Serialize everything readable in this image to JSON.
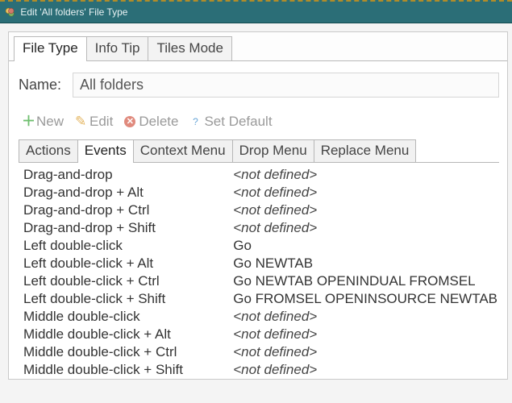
{
  "window": {
    "title": "Edit 'All folders' File Type"
  },
  "outer_tabs": [
    {
      "label": "File Type",
      "active": true
    },
    {
      "label": "Info Tip",
      "active": false
    },
    {
      "label": "Tiles Mode",
      "active": false
    }
  ],
  "name_field": {
    "label": "Name:",
    "value": "All folders"
  },
  "toolbar": {
    "new_label": "New",
    "edit_label": "Edit",
    "delete_label": "Delete",
    "set_default_label": "Set Default"
  },
  "inner_tabs": [
    {
      "label": "Actions",
      "active": false
    },
    {
      "label": "Events",
      "active": true
    },
    {
      "label": "Context Menu",
      "active": false
    },
    {
      "label": "Drop Menu",
      "active": false
    },
    {
      "label": "Replace Menu",
      "active": false
    }
  ],
  "events": [
    {
      "event": "Drag-and-drop",
      "action": "<not defined>",
      "defined": false
    },
    {
      "event": "Drag-and-drop + Alt",
      "action": "<not defined>",
      "defined": false
    },
    {
      "event": "Drag-and-drop + Ctrl",
      "action": "<not defined>",
      "defined": false
    },
    {
      "event": "Drag-and-drop + Shift",
      "action": "<not defined>",
      "defined": false
    },
    {
      "event": "Left double-click",
      "action": "Go",
      "defined": true
    },
    {
      "event": "Left double-click + Alt",
      "action": "Go NEWTAB",
      "defined": true
    },
    {
      "event": "Left double-click + Ctrl",
      "action": "Go NEWTAB OPENINDUAL FROMSEL",
      "defined": true
    },
    {
      "event": "Left double-click + Shift",
      "action": "Go FROMSEL OPENINSOURCE NEWTAB",
      "defined": true
    },
    {
      "event": "Middle double-click",
      "action": "<not defined>",
      "defined": false
    },
    {
      "event": "Middle double-click + Alt",
      "action": "<not defined>",
      "defined": false
    },
    {
      "event": "Middle double-click + Ctrl",
      "action": "<not defined>",
      "defined": false
    },
    {
      "event": "Middle double-click + Shift",
      "action": "<not defined>",
      "defined": false
    }
  ]
}
